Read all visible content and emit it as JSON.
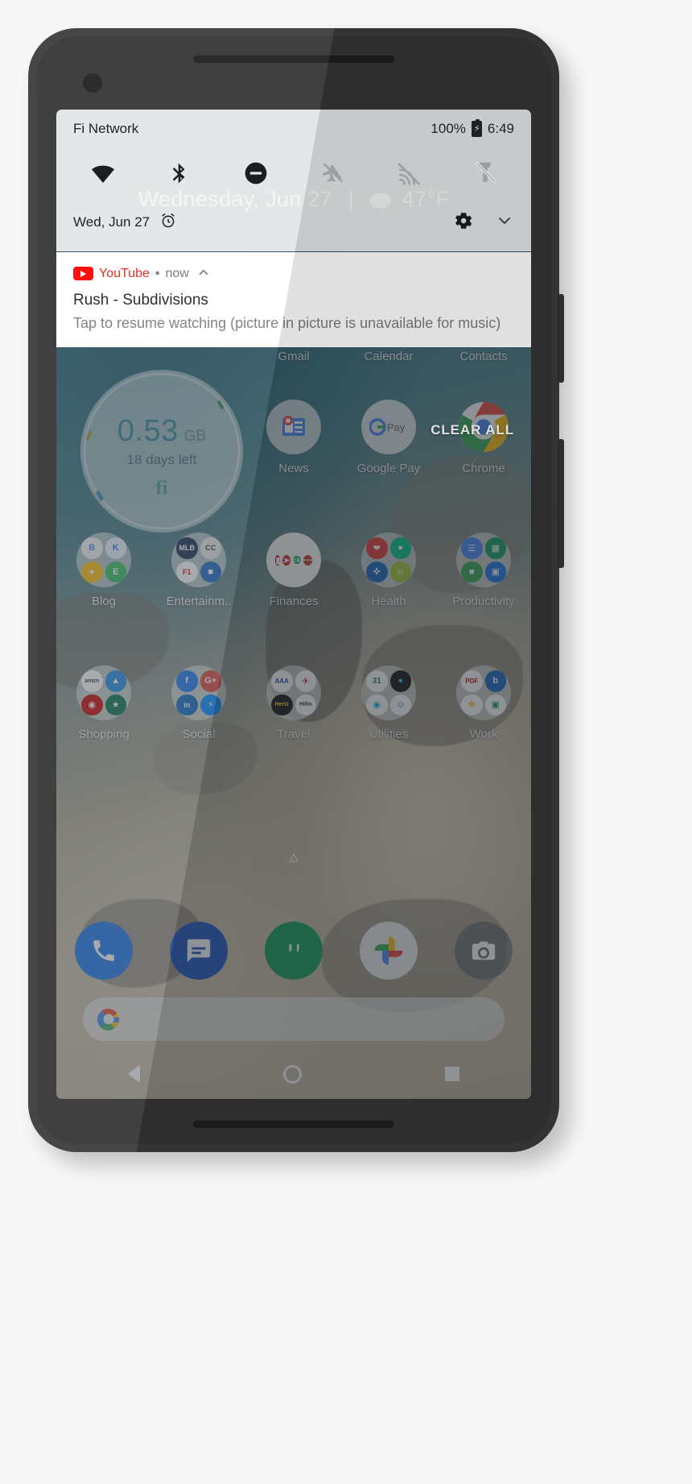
{
  "device": {
    "name": "pixel-phone"
  },
  "status_bar": {
    "carrier": "Fi Network",
    "battery_percent": "100%",
    "battery_icon": "battery-charging-icon",
    "time": "6:49"
  },
  "quick_settings": {
    "tiles": [
      {
        "name": "wifi-icon",
        "label": "Wi-Fi",
        "state": "on"
      },
      {
        "name": "bluetooth-icon",
        "label": "Bluetooth",
        "state": "on"
      },
      {
        "name": "do-not-disturb-icon",
        "label": "Do Not Disturb",
        "state": "on"
      },
      {
        "name": "airplane-mode-off-icon",
        "label": "Airplane mode",
        "state": "off"
      },
      {
        "name": "cast-off-icon",
        "label": "Cast",
        "state": "off"
      },
      {
        "name": "flashlight-off-icon",
        "label": "Flashlight",
        "state": "off"
      }
    ],
    "date": "Wed, Jun 27",
    "alarm_icon": "alarm-clock-icon",
    "settings_icon": "gear-icon",
    "expand_icon": "chevron-down-icon",
    "ghost_date": "Wednesday, Jun 27",
    "ghost_separator": "|",
    "ghost_weather": "47°F"
  },
  "notification": {
    "app": "YouTube",
    "separator": "•",
    "time": "now",
    "expand_icon": "chevron-up-icon",
    "title": "Rush - Subdivisions",
    "body": "Tap to resume watching (picture in picture is unavailable for music)"
  },
  "clear_all": {
    "label": "CLEAR ALL"
  },
  "home_screen": {
    "fi_widget": {
      "usage_value": "0.53",
      "usage_unit": "GB",
      "days_left": "18 days left",
      "logo": "fi"
    },
    "row_top_labels": [
      "Gmail",
      "Calendar",
      "Contacts"
    ],
    "rows": [
      {
        "apps": [
          {
            "label": "",
            "icon": "fi-widget-placeholder"
          },
          {
            "label": "",
            "icon": "blank"
          },
          {
            "label": "News",
            "icon": "google-news-icon"
          },
          {
            "label": "Google Pay",
            "icon": "google-pay-icon"
          },
          {
            "label": "Chrome",
            "icon": "chrome-icon"
          }
        ]
      },
      {
        "apps": [
          {
            "label": "Blog",
            "icon": "folder-icon"
          },
          {
            "label": "Entertainm..",
            "icon": "folder-icon"
          },
          {
            "label": "Finances",
            "icon": "folder-icon"
          },
          {
            "label": "Health",
            "icon": "folder-icon"
          },
          {
            "label": "Productivity",
            "icon": "folder-icon"
          }
        ]
      },
      {
        "apps": [
          {
            "label": "Shopping",
            "icon": "folder-icon"
          },
          {
            "label": "Social",
            "icon": "folder-icon"
          },
          {
            "label": "Travel",
            "icon": "folder-icon"
          },
          {
            "label": "Utilities",
            "icon": "folder-icon"
          },
          {
            "label": "Work",
            "icon": "folder-icon"
          }
        ]
      }
    ],
    "all_apps_icon": "chevron-up-icon",
    "dock": [
      {
        "label": "Phone",
        "icon": "phone-icon"
      },
      {
        "label": "Messages",
        "icon": "messages-icon"
      },
      {
        "label": "Hangouts",
        "icon": "hangouts-icon"
      },
      {
        "label": "Photos",
        "icon": "google-photos-icon"
      },
      {
        "label": "Camera",
        "icon": "camera-icon"
      }
    ],
    "search_bar": {
      "icon": "google-g-icon",
      "placeholder": ""
    }
  },
  "nav_bar": {
    "back": "back-button",
    "home": "home-button",
    "recents": "recents-button"
  },
  "colors": {
    "youtube_red": "#e62117",
    "shade_bg": "#e2e6e7",
    "card_bg": "#ffffff",
    "fi_teal": "#2a7f93"
  }
}
